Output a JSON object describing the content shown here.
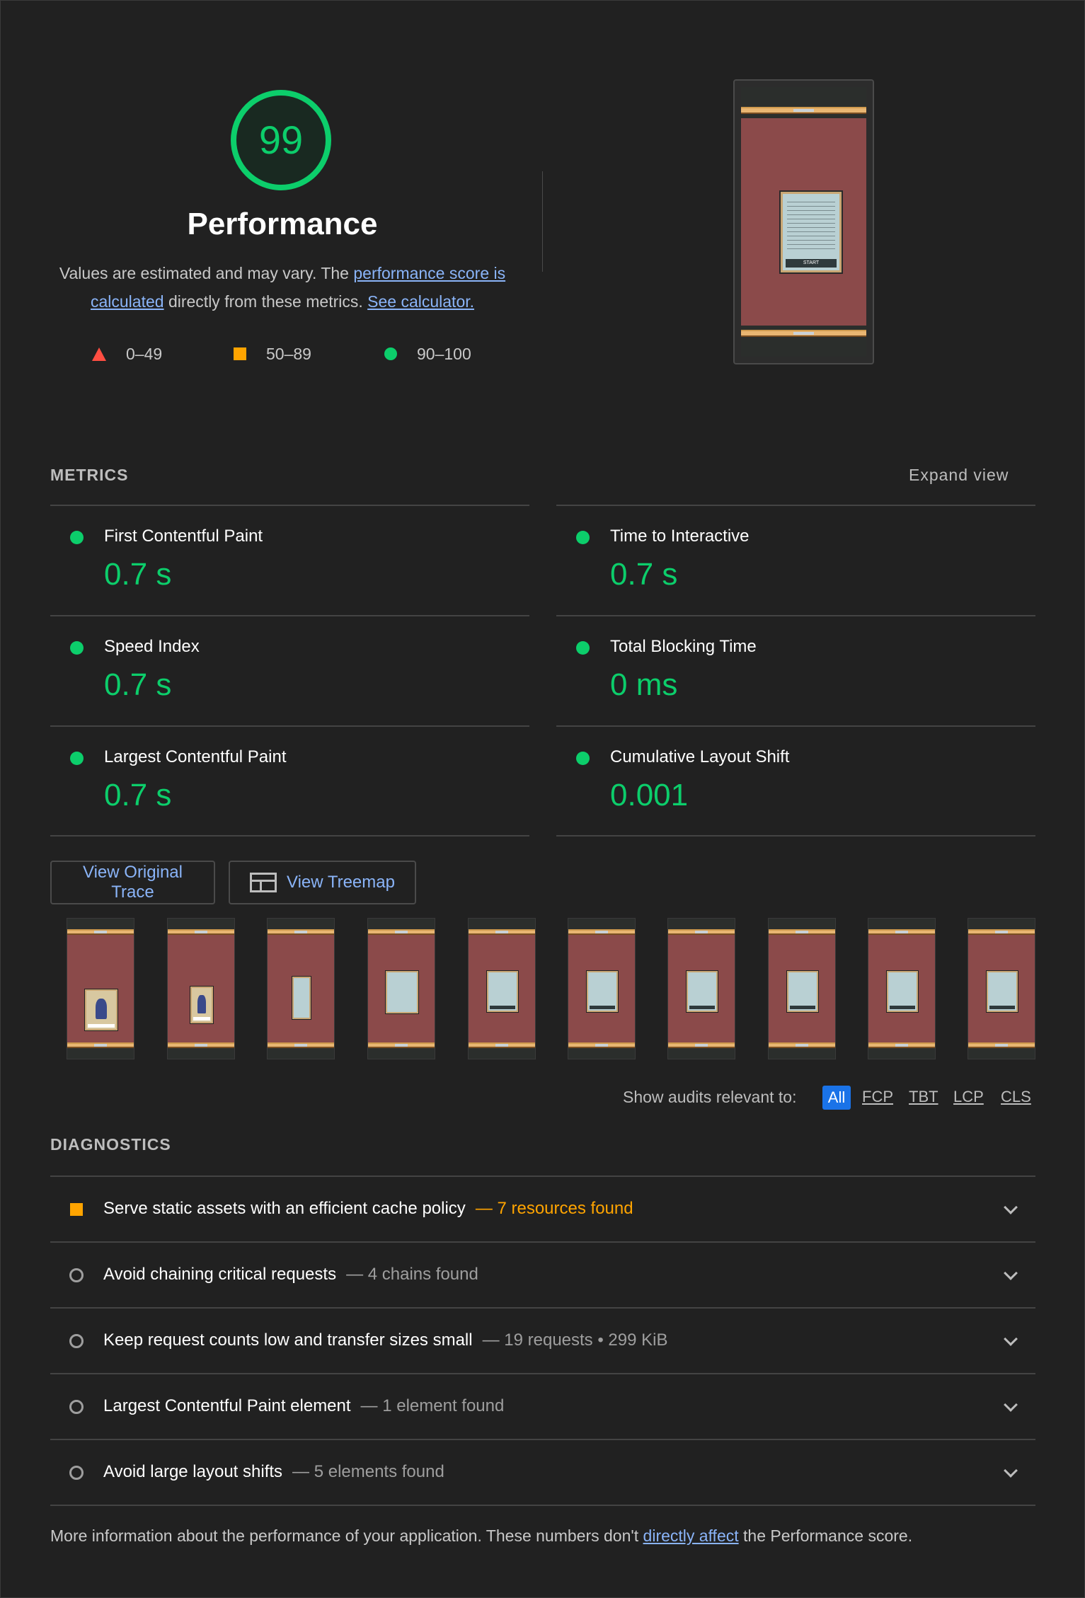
{
  "header": {
    "score": "99",
    "title": "Performance",
    "desc_prefix": "Values are estimated and may vary. The ",
    "desc_link1": "performance score is calculated",
    "desc_middle": " directly from these metrics. ",
    "desc_link2": "See calculator.",
    "legend": [
      {
        "range": "0–49",
        "icon": "red-triangle",
        "color": "#ff4e42"
      },
      {
        "range": "50–89",
        "icon": "orange-square",
        "color": "#ffa400"
      },
      {
        "range": "90–100",
        "icon": "green-circle",
        "color": "#0cce6b"
      }
    ],
    "screenshot": {
      "card_button": "START"
    }
  },
  "metrics": {
    "title": "METRICS",
    "expand_label": "Expand view",
    "items": [
      {
        "label": "First Contentful Paint",
        "value": "0.7 s"
      },
      {
        "label": "Time to Interactive",
        "value": "0.7 s"
      },
      {
        "label": "Speed Index",
        "value": "0.7 s"
      },
      {
        "label": "Total Blocking Time",
        "value": "0 ms"
      },
      {
        "label": "Largest Contentful Paint",
        "value": "0.7 s"
      },
      {
        "label": "Cumulative Layout Shift",
        "value": "0.001"
      }
    ]
  },
  "buttons": {
    "view_trace": "View Original Trace",
    "view_treemap": "View Treemap"
  },
  "filters": {
    "label": "Show audits relevant to:",
    "options": [
      "All",
      "FCP",
      "TBT",
      "LCP",
      "CLS"
    ],
    "selected": "All"
  },
  "diagnostics": {
    "title": "DIAGNOSTICS",
    "items": [
      {
        "title": "Serve static assets with an efficient cache policy",
        "detail": "— 7 resources found",
        "status": "warn"
      },
      {
        "title": "Avoid chaining critical requests",
        "detail": "— 4 chains found",
        "status": "info"
      },
      {
        "title": "Keep request counts low and transfer sizes small",
        "detail": "— 19 requests • 299 KiB",
        "status": "info"
      },
      {
        "title": "Largest Contentful Paint element",
        "detail": "— 1 element found",
        "status": "info"
      },
      {
        "title": "Avoid large layout shifts",
        "detail": "— 5 elements found",
        "status": "info"
      }
    ],
    "footer_prefix": "More information about the performance of your application. These numbers don't ",
    "footer_link": "directly affect",
    "footer_suffix": " the Performance score."
  },
  "colors": {
    "pass": "#0cce6b",
    "average": "#ffa400",
    "fail": "#ff4e42",
    "link": "#8ab4f8",
    "accent": "#1a73e8",
    "background": "#212121"
  }
}
